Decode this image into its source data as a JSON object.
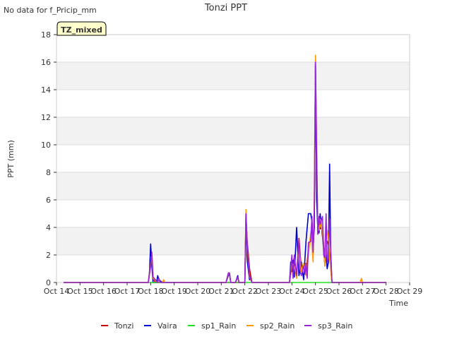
{
  "chart_data": {
    "type": "line",
    "title": "Tonzi PPT",
    "no_data_note": "No data for f_Pricip_mm",
    "badge": "TZ_mixed",
    "xlabel": "Time",
    "ylabel": "PPT (mm)",
    "ylim": [
      0,
      18
    ],
    "yticks": [
      0,
      2,
      4,
      6,
      8,
      10,
      12,
      14,
      16,
      18
    ],
    "xlim": [
      14,
      29
    ],
    "xticks": [
      {
        "v": 14,
        "label": "Oct 14"
      },
      {
        "v": 15,
        "label": "Oct 15"
      },
      {
        "v": 16,
        "label": "Oct 16"
      },
      {
        "v": 17,
        "label": "Oct 17"
      },
      {
        "v": 18,
        "label": "Oct 18"
      },
      {
        "v": 19,
        "label": "Oct 19"
      },
      {
        "v": 20,
        "label": "Oct 20"
      },
      {
        "v": 21,
        "label": "Oct 21"
      },
      {
        "v": 22,
        "label": "Oct 22"
      },
      {
        "v": 23,
        "label": "Oct 23"
      },
      {
        "v": 24,
        "label": "Oct 24"
      },
      {
        "v": 25,
        "label": "Oct 25"
      },
      {
        "v": 26,
        "label": "Oct 26"
      },
      {
        "v": 27,
        "label": "Oct 27"
      },
      {
        "v": 28,
        "label": "Oct 28"
      },
      {
        "v": 29,
        "label": "Oct 29"
      }
    ],
    "grid": true,
    "legend_position": "bottom-center",
    "series": [
      {
        "name": "Tonzi",
        "color": "#cc0000",
        "x": [
          14.3,
          17.9,
          18.0,
          18.05,
          18.1,
          18.2,
          18.4,
          21.2,
          21.5,
          22.0,
          22.05,
          22.1,
          22.2,
          22.3,
          23.9,
          24.0,
          24.1,
          24.2,
          24.3,
          24.4,
          24.5,
          24.6,
          24.7,
          24.8,
          24.85,
          24.9,
          24.95,
          25.0,
          25.05,
          25.1,
          25.15,
          25.2,
          25.3,
          25.4,
          25.5,
          25.55,
          25.6,
          25.7,
          28.0
        ],
        "y": [
          0,
          0,
          1.2,
          2.0,
          0.3,
          0,
          0,
          0,
          0,
          0,
          4.8,
          3.0,
          1.0,
          0,
          0,
          1.2,
          1.8,
          0.5,
          3.2,
          1.0,
          1.3,
          0.6,
          2.4,
          3.2,
          4.5,
          2.0,
          5.0,
          15.8,
          9.0,
          3.6,
          4.5,
          3.9,
          4.0,
          1.2,
          3.0,
          2.8,
          2.0,
          0,
          0
        ]
      },
      {
        "name": "Vaira",
        "color": "#0000cc",
        "x": [
          14.3,
          17.9,
          17.95,
          18.0,
          18.05,
          18.1,
          18.25,
          18.3,
          18.35,
          18.5,
          21.2,
          21.3,
          21.35,
          21.4,
          21.6,
          21.7,
          21.75,
          21.8,
          22.0,
          22.05,
          22.1,
          22.2,
          22.25,
          22.3,
          22.35,
          23.9,
          23.95,
          24.0,
          24.05,
          24.1,
          24.2,
          24.3,
          24.4,
          24.45,
          24.5,
          24.6,
          24.7,
          24.8,
          24.85,
          24.9,
          24.95,
          25.0,
          25.05,
          25.1,
          25.15,
          25.2,
          25.3,
          25.4,
          25.45,
          25.5,
          25.55,
          25.6,
          25.65,
          25.7,
          28.0
        ],
        "y": [
          0,
          0,
          0.8,
          2.8,
          1.2,
          0,
          0,
          0.5,
          0.2,
          0,
          0,
          0.5,
          0.6,
          0,
          0,
          0.5,
          0,
          0,
          0,
          5.0,
          1.6,
          0.2,
          0.3,
          0,
          0,
          0,
          1.5,
          0.8,
          1.6,
          0.4,
          4.0,
          0.5,
          1.5,
          0.8,
          0.2,
          3.0,
          5.0,
          5.0,
          4.4,
          2.5,
          4.0,
          16.0,
          6.0,
          3.9,
          3.6,
          5.0,
          3.3,
          1.3,
          2.0,
          1.0,
          1.5,
          8.6,
          2.0,
          0,
          0
        ]
      },
      {
        "name": "sp1_Rain",
        "color": "#22dd22",
        "x": [
          14.3,
          28.0
        ],
        "y": [
          0,
          0
        ]
      },
      {
        "name": "sp2_Rain",
        "color": "#ff9900",
        "x": [
          14.3,
          17.9,
          18.0,
          18.05,
          18.1,
          18.3,
          18.35,
          18.4,
          18.5,
          18.55,
          18.6,
          21.2,
          21.3,
          21.35,
          21.4,
          21.6,
          21.7,
          21.75,
          21.8,
          22.0,
          22.05,
          22.1,
          22.2,
          22.3,
          23.9,
          24.0,
          24.1,
          24.2,
          24.3,
          24.4,
          24.5,
          24.6,
          24.7,
          24.8,
          24.85,
          24.9,
          24.95,
          25.0,
          25.05,
          25.1,
          25.15,
          25.2,
          25.3,
          25.4,
          25.5,
          25.55,
          25.6,
          25.7,
          26.9,
          26.95,
          27.0,
          28.0
        ],
        "y": [
          0,
          0,
          1.4,
          1.8,
          0.3,
          0,
          0.3,
          0,
          0,
          0.2,
          0,
          0,
          0.6,
          0.7,
          0,
          0,
          0.4,
          0,
          0,
          0,
          5.3,
          2.5,
          0.4,
          0,
          0,
          1.4,
          1.2,
          0.3,
          2.8,
          0.8,
          1.4,
          0.5,
          2.0,
          3.6,
          2.8,
          1.5,
          6.2,
          16.5,
          9.2,
          4.2,
          3.8,
          4.6,
          3.6,
          1.2,
          3.8,
          3.3,
          1.8,
          0,
          0,
          0.3,
          0,
          0
        ]
      },
      {
        "name": "sp3_Rain",
        "color": "#9922dd",
        "x": [
          14.3,
          17.9,
          18.0,
          18.05,
          18.1,
          18.3,
          18.35,
          18.4,
          18.5,
          21.2,
          21.3,
          21.35,
          21.4,
          21.6,
          21.7,
          21.75,
          21.8,
          22.0,
          22.05,
          22.1,
          22.2,
          22.3,
          23.9,
          24.0,
          24.05,
          24.1,
          24.2,
          24.3,
          24.35,
          24.4,
          24.5,
          24.55,
          24.6,
          24.65,
          24.7,
          24.8,
          24.85,
          24.9,
          24.95,
          25.0,
          25.05,
          25.1,
          25.15,
          25.2,
          25.3,
          25.35,
          25.4,
          25.45,
          25.5,
          25.55,
          25.6,
          25.7,
          28.0
        ],
        "y": [
          0,
          0,
          1.3,
          2.2,
          0.4,
          0,
          0.3,
          0,
          0,
          0,
          0.7,
          0.7,
          0,
          0,
          0.4,
          0,
          0,
          0,
          5.0,
          2.8,
          0.5,
          0,
          0,
          2.0,
          0.3,
          2.0,
          0.5,
          3.1,
          0.8,
          0.5,
          1.2,
          0.6,
          1.4,
          0.3,
          2.9,
          3.0,
          4.8,
          2.2,
          5.3,
          16.0,
          9.9,
          3.5,
          4.8,
          4.2,
          4.8,
          2.0,
          1.8,
          5.0,
          1.5,
          1.8,
          4.6,
          0,
          0
        ]
      }
    ]
  }
}
